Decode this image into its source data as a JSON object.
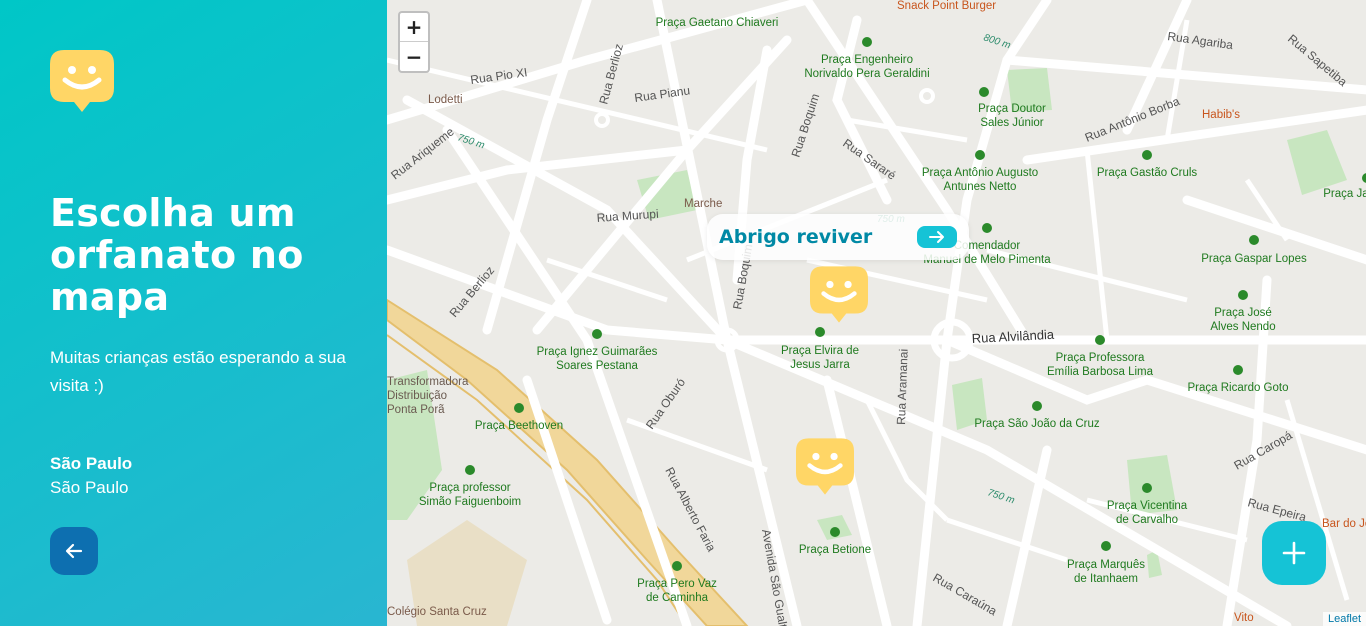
{
  "sidebar": {
    "title": "Escolha um orfanato no mapa",
    "subtitle": "Muitas crianças estão esperando a sua visita :)",
    "city": "São Paulo",
    "state": "São Paulo",
    "logo_icon": "smiley-logo-icon",
    "back_icon": "arrow-left-icon",
    "colors": {
      "gradient_start": "#29b6d1",
      "gradient_end": "#00c7c7",
      "logo": "#ffd666",
      "back_button": "#0d6fb0"
    }
  },
  "map": {
    "zoom_in_label": "+",
    "zoom_out_label": "−",
    "popup": {
      "name": "Abrigo reviver",
      "icon": "arrow-right-icon"
    },
    "add_icon": "plus-icon",
    "attribution": "Leaflet",
    "colors": {
      "accent": "#15c3d6",
      "popup_text": "#0089a5",
      "park": "#c8e6c0",
      "label_green": "#1f7a1f"
    },
    "labels": {
      "streets": [
        "Rua Pio XI",
        "Rua Berlioz",
        "Rua Pianu",
        "Rua Ariqueme",
        "Rua Murupi",
        "Rua Boquim",
        "Rua Sararé",
        "Rua Antônio Borba",
        "Rua Agariba",
        "Rua Sapetiba",
        "Rua Alvilândia",
        "Rua Oburó",
        "Rua Alberto Faria",
        "Avenida São Gualter",
        "Rua Aramanai",
        "Rua Caraúna",
        "Rua Caropá",
        "Rua Epeira"
      ],
      "parks": [
        "Praça Gaetano Chiaveri",
        "Praça Engenheiro Norivaldo Pera Geraldini",
        "Praça Doutor Sales Júnior",
        "Praça Antônio Augusto Antunes Netto",
        "Praça Gastão Cruls",
        "Praça Comendador Manuel de Melo Pimenta",
        "Praça Gaspar Lopes",
        "Praça José Alves Nendo",
        "Praça Ignez Guimarães Soares Pestana",
        "Praça Elvira de Jesus Jarra",
        "Praça Professora Emília Barbosa Lima",
        "Praça Ricardo Goto",
        "Praça Beethoven",
        "Praça São João da Cruz",
        "Praça professor Simão Faiguenboim",
        "Praça Vicentina de Carvalho",
        "Praça Betione",
        "Praça Marquês de Itanhaem",
        "Praça Pero Vaz de Caminha"
      ],
      "pois": [
        "Snack Point Burger",
        "Lodetti",
        "Marche",
        "Habib's",
        "Transformadora Distribuição Ponta Porã",
        "Colégio Santa Cruz",
        "Bar do João",
        "Vito"
      ],
      "distances": [
        "800 m",
        "750 m",
        "750 m",
        "750 m"
      ]
    }
  }
}
